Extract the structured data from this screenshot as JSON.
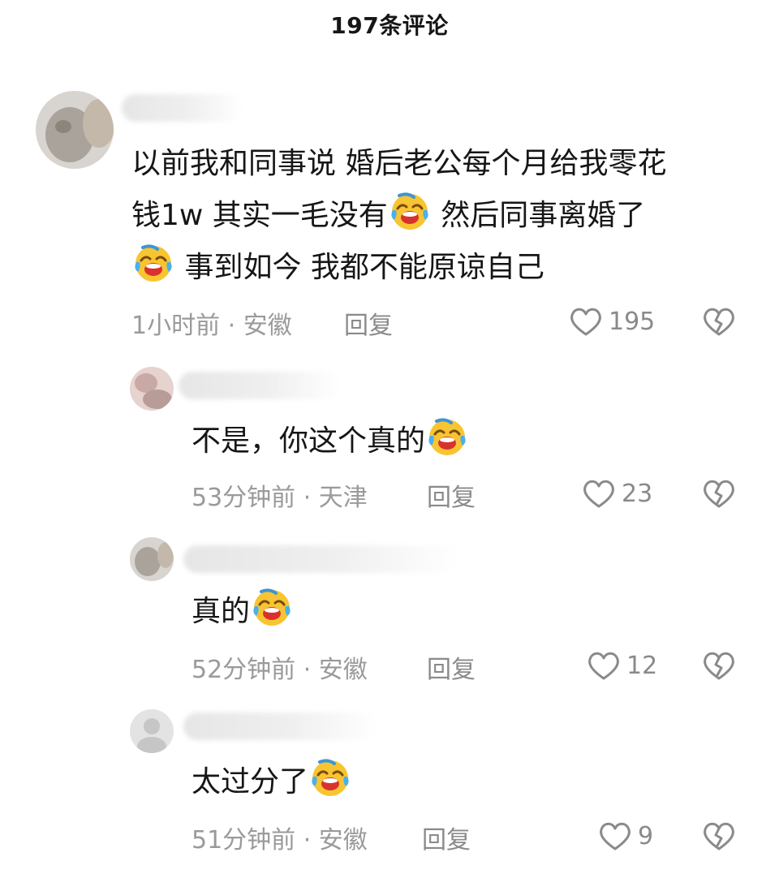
{
  "header": {
    "title": "197条评论"
  },
  "comments": [
    {
      "lines": [
        "以前我和同事说  婚后老公每个月给我零花",
        "钱1w  其实一毛没有",
        "  然后同事离婚了",
        "事到如今 我都不能原谅自己"
      ],
      "time_location": "1小时前 · 安徽",
      "reply_label": "回复",
      "likes": "195"
    },
    {
      "text": "不是，你这个真的",
      "time_location": "53分钟前 · 天津",
      "reply_label": "回复",
      "likes": "23"
    },
    {
      "text": "真的",
      "time_location": "52分钟前 · 安徽",
      "reply_label": "回复",
      "likes": "12"
    },
    {
      "text": "太过分了",
      "time_location": "51分钟前 · 安徽",
      "reply_label": "回复",
      "likes": "9"
    }
  ],
  "icons": {
    "like": "heart-outline-icon",
    "dislike": "broken-heart-icon",
    "emoji": "crying-laughing-emoji"
  },
  "colors": {
    "text": "#161616",
    "meta": "#9a9a9a",
    "icon": "#8a8a8a"
  }
}
